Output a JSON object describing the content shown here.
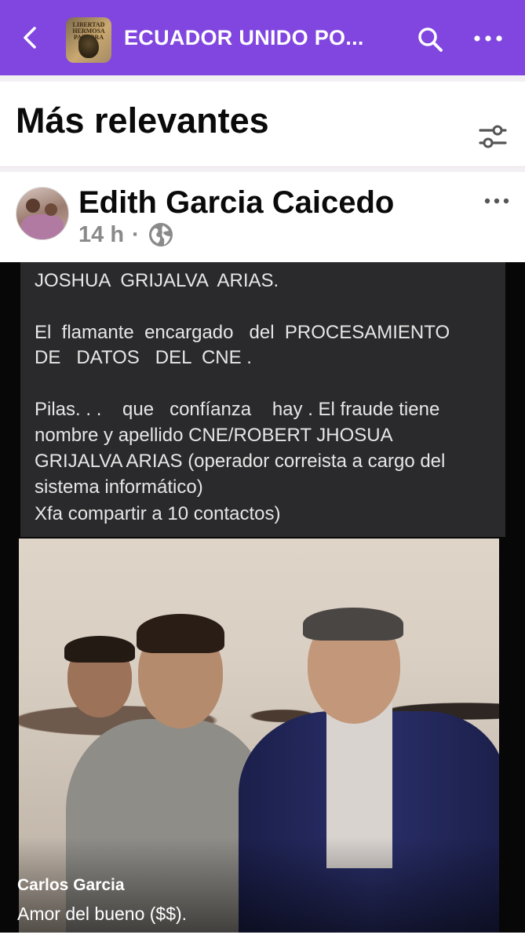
{
  "header": {
    "title": "ECUADOR UNIDO PO...",
    "back_icon": "chevron-left-icon",
    "search_icon": "search-icon",
    "more_icon": "more-horizontal-icon",
    "bg_color": "#8146e0",
    "thumb_text": "LIBERTAD HERMOSA PALABRA"
  },
  "section": {
    "title": "Más relevantes",
    "filter_icon": "filter-sliders-icon"
  },
  "post": {
    "author": "Edith Garcia Caicedo",
    "time": "14 h",
    "separator": "·",
    "privacy_icon": "globe-icon",
    "more_icon": "more-horizontal-icon",
    "image_text_lines": [
      "JOSHUA  GRIJALVA  ARIAS.",
      "",
      "El  flamante  encargado   del  PROCESAMIENTO",
      "DE   DATOS   DEL  CNE .",
      "",
      "Pilas. . .    que   confíanza    hay . El fraude tiene",
      "nombre y apellido CNE/ROBERT JHOSUA",
      "GRIJALVA ARIAS (operador correista a cargo del",
      "sistema informático)",
      "Xfa compartir a 10 contactos)"
    ],
    "caption_name": "Carlos Garcia",
    "caption_text": "Amor del bueno ($$)."
  }
}
